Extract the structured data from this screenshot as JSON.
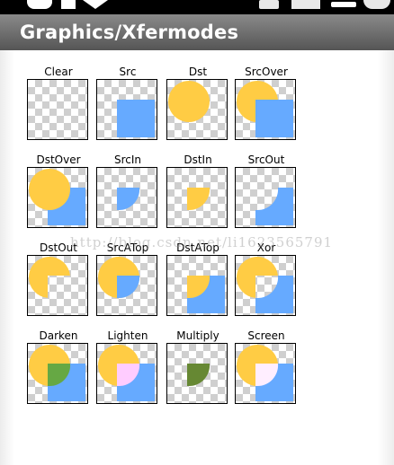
{
  "app": {
    "title": "Graphics/Xfermodes"
  },
  "colors": {
    "dst": "#ffcc44",
    "src": "#66aaff",
    "darken": "#66a844",
    "lighten": "#ffccff",
    "multiply": "#668833",
    "screen": "#ffeeff"
  },
  "modes": [
    {
      "label": "Clear"
    },
    {
      "label": "Src"
    },
    {
      "label": "Dst"
    },
    {
      "label": "SrcOver"
    },
    {
      "label": "DstOver"
    },
    {
      "label": "SrcIn"
    },
    {
      "label": "DstIn"
    },
    {
      "label": "SrcOut"
    },
    {
      "label": "DstOut"
    },
    {
      "label": "SrcATop"
    },
    {
      "label": "DstATop"
    },
    {
      "label": "Xor"
    },
    {
      "label": "Darken"
    },
    {
      "label": "Lighten"
    },
    {
      "label": "Multiply"
    },
    {
      "label": "Screen"
    }
  ],
  "watermark": "http://blog.csdn.net/li1623565791"
}
